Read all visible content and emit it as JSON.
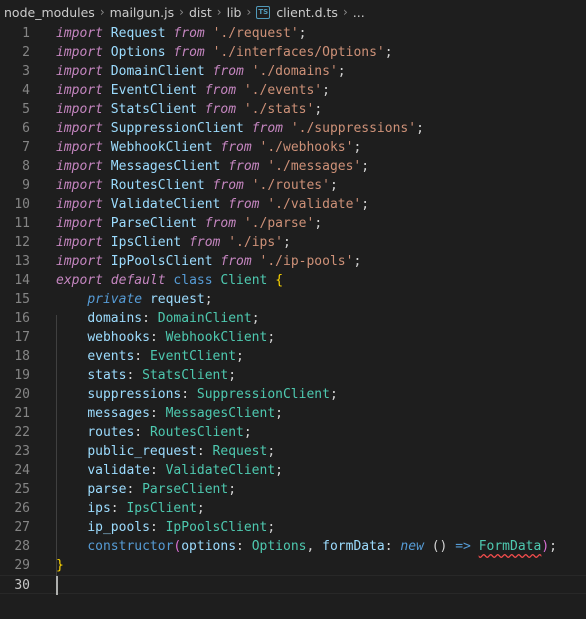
{
  "breadcrumb": {
    "items": [
      "node_modules",
      "mailgun.js",
      "dist",
      "lib"
    ],
    "file_icon_label": "TS",
    "file": "client.d.ts",
    "more": "..."
  },
  "editor": {
    "line_numbers": [
      "1",
      "2",
      "3",
      "4",
      "5",
      "6",
      "7",
      "8",
      "9",
      "10",
      "11",
      "12",
      "13",
      "14",
      "15",
      "16",
      "17",
      "18",
      "19",
      "20",
      "21",
      "22",
      "23",
      "24",
      "25",
      "26",
      "27",
      "28",
      "29",
      "30"
    ],
    "imports": [
      {
        "kw": "import",
        "name": "Request",
        "from": "from",
        "path": "'./request'",
        "semi": ";"
      },
      {
        "kw": "import",
        "name": "Options",
        "from": "from",
        "path": "'./interfaces/Options'",
        "semi": ";"
      },
      {
        "kw": "import",
        "name": "DomainClient",
        "from": "from",
        "path": "'./domains'",
        "semi": ";"
      },
      {
        "kw": "import",
        "name": "EventClient",
        "from": "from",
        "path": "'./events'",
        "semi": ";"
      },
      {
        "kw": "import",
        "name": "StatsClient",
        "from": "from",
        "path": "'./stats'",
        "semi": ";"
      },
      {
        "kw": "import",
        "name": "SuppressionClient",
        "from": "from",
        "path": "'./suppressions'",
        "semi": ";"
      },
      {
        "kw": "import",
        "name": "WebhookClient",
        "from": "from",
        "path": "'./webhooks'",
        "semi": ";"
      },
      {
        "kw": "import",
        "name": "MessagesClient",
        "from": "from",
        "path": "'./messages'",
        "semi": ";"
      },
      {
        "kw": "import",
        "name": "RoutesClient",
        "from": "from",
        "path": "'./routes'",
        "semi": ";"
      },
      {
        "kw": "import",
        "name": "ValidateClient",
        "from": "from",
        "path": "'./validate'",
        "semi": ";"
      },
      {
        "kw": "import",
        "name": "ParseClient",
        "from": "from",
        "path": "'./parse'",
        "semi": ";"
      },
      {
        "kw": "import",
        "name": "IpsClient",
        "from": "from",
        "path": "'./ips'",
        "semi": ";"
      },
      {
        "kw": "import",
        "name": "IpPoolsClient",
        "from": "from",
        "path": "'./ip-pools'",
        "semi": ";"
      }
    ],
    "class_decl": {
      "export": "export",
      "default": "default",
      "class": "class",
      "name": "Client",
      "open": "{"
    },
    "private_member": {
      "modifier": "private",
      "name": "request",
      "semi": ";"
    },
    "members": [
      {
        "name": "domains",
        "colon": ": ",
        "type": "DomainClient",
        "semi": ";"
      },
      {
        "name": "webhooks",
        "colon": ": ",
        "type": "WebhookClient",
        "semi": ";"
      },
      {
        "name": "events",
        "colon": ": ",
        "type": "EventClient",
        "semi": ";"
      },
      {
        "name": "stats",
        "colon": ": ",
        "type": "StatsClient",
        "semi": ";"
      },
      {
        "name": "suppressions",
        "colon": ": ",
        "type": "SuppressionClient",
        "semi": ";"
      },
      {
        "name": "messages",
        "colon": ": ",
        "type": "MessagesClient",
        "semi": ";"
      },
      {
        "name": "routes",
        "colon": ": ",
        "type": "RoutesClient",
        "semi": ";"
      },
      {
        "name": "public_request",
        "colon": ": ",
        "type": "Request",
        "semi": ";"
      },
      {
        "name": "validate",
        "colon": ": ",
        "type": "ValidateClient",
        "semi": ";"
      },
      {
        "name": "parse",
        "colon": ": ",
        "type": "ParseClient",
        "semi": ";"
      },
      {
        "name": "ips",
        "colon": ": ",
        "type": "IpsClient",
        "semi": ";"
      },
      {
        "name": "ip_pools",
        "colon": ": ",
        "type": "IpPoolsClient",
        "semi": ";"
      }
    ],
    "ctor": {
      "name": "constructor",
      "open": "(",
      "p1": "options",
      "c1": ": ",
      "t1": "Options",
      "comma": ", ",
      "p2": "formData",
      "c2": ": ",
      "newkw": "new",
      "parens": " () ",
      "arrow": "=>",
      "sp": " ",
      "t2": "FormData",
      "close": ")",
      "semi": ";"
    },
    "close_brace": "}"
  },
  "colors": {
    "background": "#1e1e1e",
    "keyword": "#569cd6",
    "control": "#c586c0",
    "type": "#4ec9b0",
    "string": "#ce9178",
    "variable": "#9cdcfe",
    "function": "#dcdcaa",
    "bracket": "#ffd700",
    "error_squiggle": "#f14c4c"
  }
}
